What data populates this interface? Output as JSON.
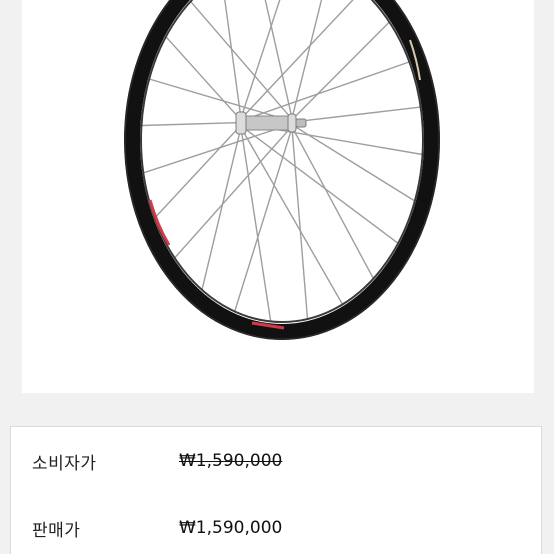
{
  "product": {
    "image_alt": "road bicycle wheel",
    "rim_colors": {
      "rim": "#111111",
      "spoke": "#9a9a9a",
      "hub": "#bfbfbf",
      "decal_red": "#d23a4a"
    }
  },
  "prices": {
    "retail_label": "소비자가",
    "retail_value": "₩1,590,000",
    "sale_label": "판매가",
    "sale_value": "₩1,590,000"
  }
}
